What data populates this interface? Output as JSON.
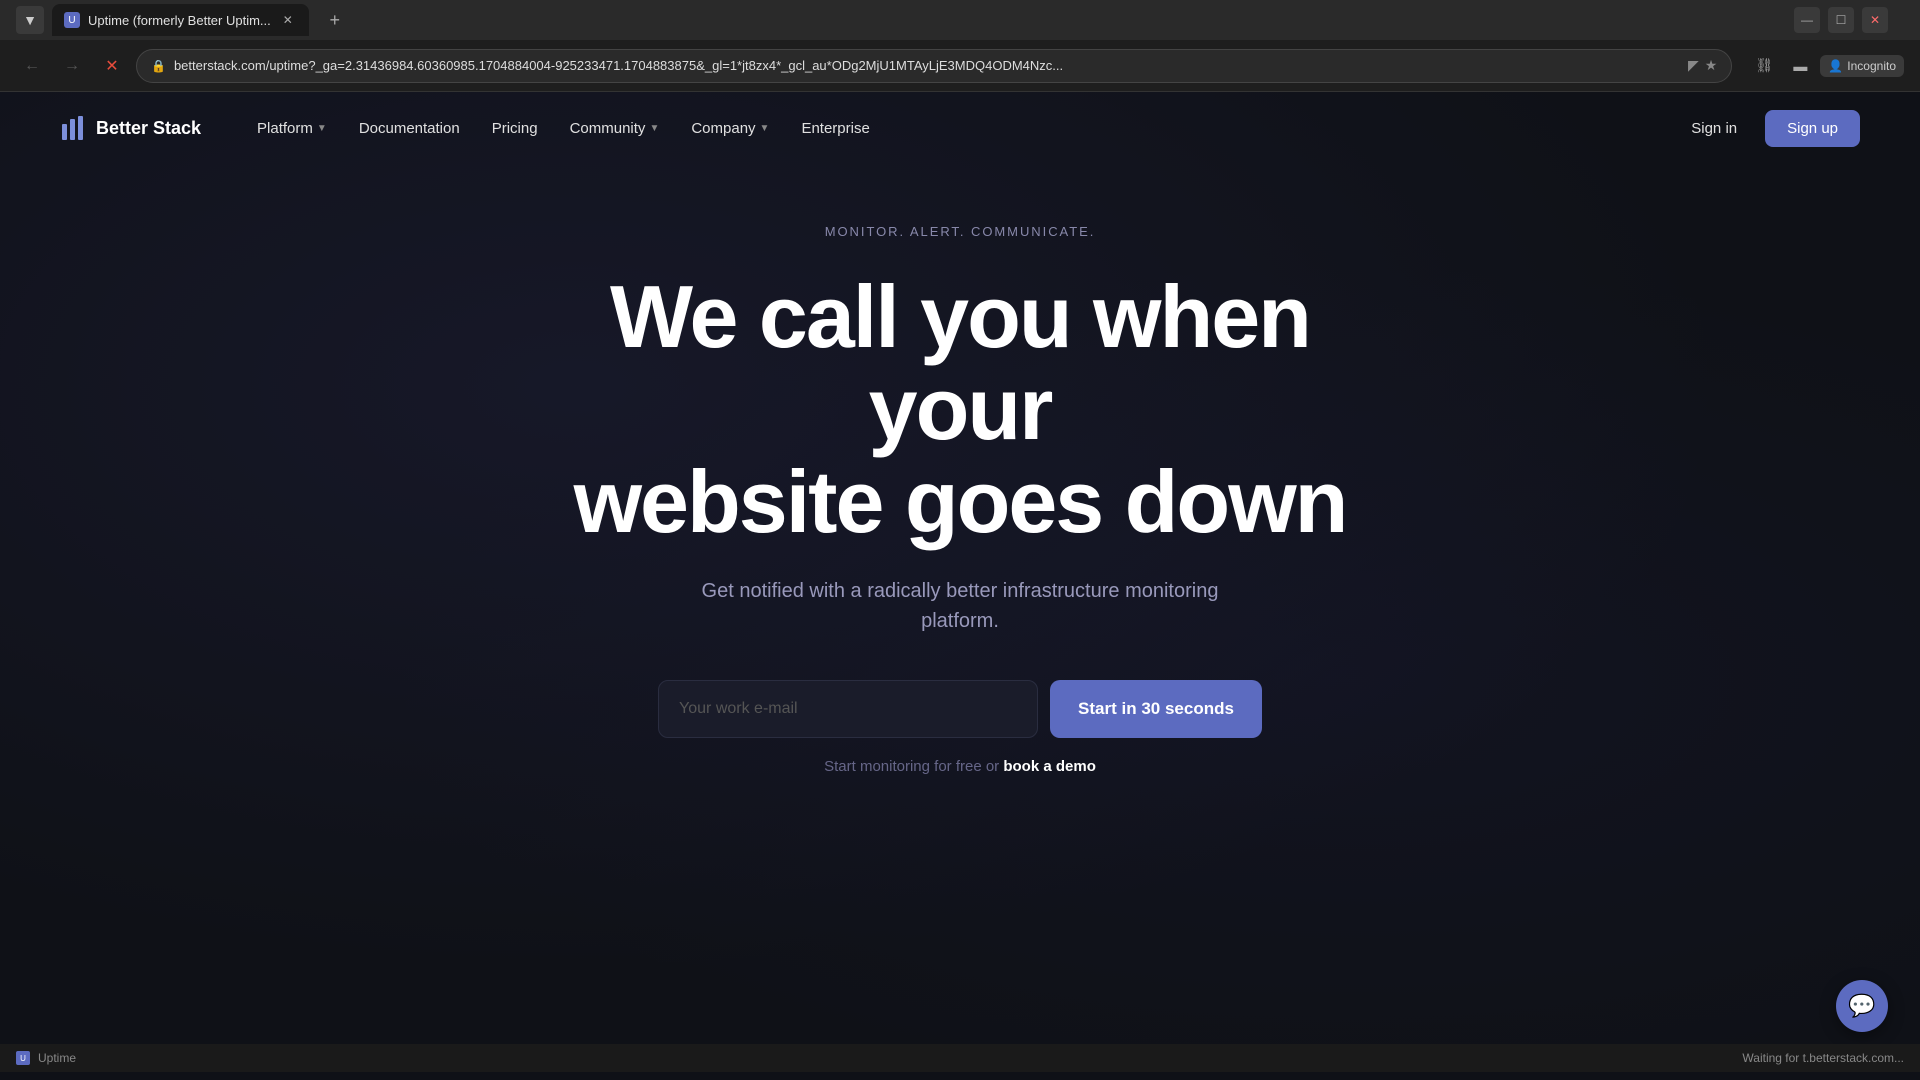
{
  "browser": {
    "tab": {
      "title": "Uptime (formerly Better Uptim...",
      "favicon": "U"
    },
    "addressBar": {
      "url": "betterstack.com/uptime?_ga=2.31436984.60360985.1704884004-925233471.1704883875&_gl=1*jt8zx4*_gcl_au*ODg2MjU1MTAyLjE3MDQ4ODM4Nzc..."
    },
    "windowControls": {
      "minimize": "—",
      "maximize": "☐",
      "close": "✕"
    },
    "incognitoLabel": "Incognito"
  },
  "nav": {
    "logo": "Better Stack",
    "links": [
      {
        "label": "Platform",
        "hasDropdown": true
      },
      {
        "label": "Documentation",
        "hasDropdown": false
      },
      {
        "label": "Pricing",
        "hasDropdown": false
      },
      {
        "label": "Community",
        "hasDropdown": true
      },
      {
        "label": "Company",
        "hasDropdown": true
      },
      {
        "label": "Enterprise",
        "hasDropdown": false
      }
    ],
    "signIn": "Sign in",
    "signUp": "Sign up"
  },
  "hero": {
    "tagline": "MONITOR. ALERT. COMMUNICATE.",
    "title_line1": "We call you when your",
    "title_line2": "website goes down",
    "subtitle": "Get notified with a radically better infrastructure monitoring platform.",
    "emailPlaceholder": "Your work e-mail",
    "ctaButton": "Start in 30 seconds",
    "footerText": "Start monitoring for free or ",
    "footerLink": "book a demo"
  },
  "statusBar": {
    "faviconText": "U",
    "siteName": "Uptime",
    "loadingText": "Waiting for t.betterstack.com..."
  },
  "chatWidget": {
    "icon": "💬"
  },
  "colors": {
    "accent": "#5c6bc0",
    "background": "#0f1117",
    "navBackground": "#0f1117",
    "text": "#ffffff",
    "mutedText": "#9999bb",
    "tagline": "#8888aa"
  }
}
